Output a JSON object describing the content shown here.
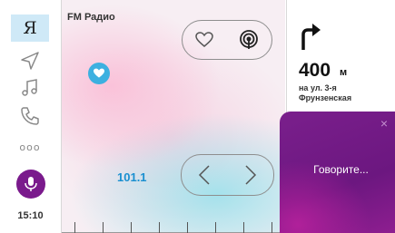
{
  "sidebar": {
    "yandex_label": "Я",
    "icons": [
      "navigation-icon",
      "music-icon",
      "phone-icon",
      "more-icon",
      "microphone-icon"
    ],
    "more_label": "ooo",
    "clock": "15:10"
  },
  "radio": {
    "title": "FM Радио",
    "frequency": "101.1"
  },
  "navigation": {
    "distance": "400",
    "unit": "м",
    "street_line1": "на ул. 3-я",
    "street_line2": "Фрунзенская"
  },
  "voice_assistant": {
    "prompt": "Говорите...",
    "close_label": "×"
  },
  "colors": {
    "accent_purple": "#7a1a8c",
    "accent_blue": "#1a8fd0",
    "favorite_blue": "#3db0e0"
  }
}
